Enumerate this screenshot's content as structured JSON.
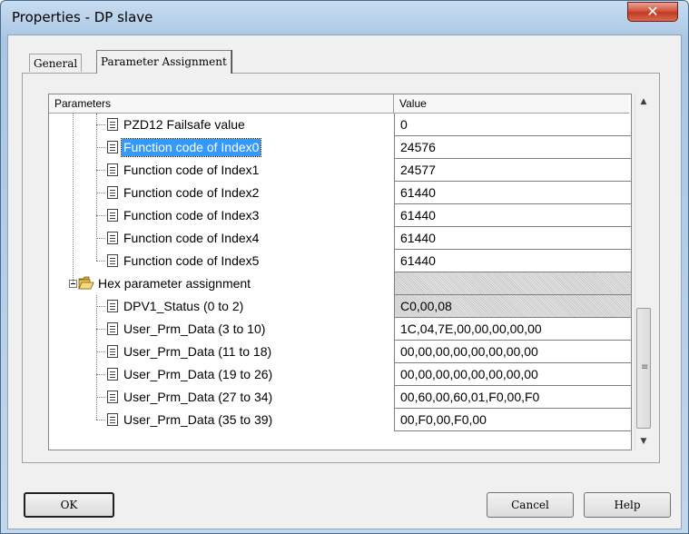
{
  "window": {
    "title": "Properties - DP slave",
    "close_glyph": "✕"
  },
  "tabs": [
    {
      "label": "General",
      "active": false
    },
    {
      "label": "Parameter Assignment",
      "active": true
    }
  ],
  "grid": {
    "columns": {
      "name": "Parameters",
      "value": "Value"
    },
    "rows": [
      {
        "label": "PZD12 Failsafe value",
        "value": "0",
        "kind": "item",
        "selected": false
      },
      {
        "label": "Function code of Index0",
        "value": "24576",
        "kind": "item",
        "selected": true
      },
      {
        "label": "Function code of Index1",
        "value": "24577",
        "kind": "item",
        "selected": false
      },
      {
        "label": "Function code of Index2",
        "value": "61440",
        "kind": "item",
        "selected": false
      },
      {
        "label": "Function code of Index3",
        "value": "61440",
        "kind": "item",
        "selected": false
      },
      {
        "label": "Function code of Index4",
        "value": "61440",
        "kind": "item",
        "selected": false
      },
      {
        "label": "Function code of Index5",
        "value": "61440",
        "kind": "item",
        "selected": false
      },
      {
        "label": "Hex parameter assignment",
        "value": "",
        "kind": "folder",
        "selected": false
      },
      {
        "label": "DPV1_Status (0 to 2)",
        "value": "C0,00,08",
        "kind": "item-hatched",
        "selected": false
      },
      {
        "label": "User_Prm_Data (3 to 10)",
        "value": "1C,04,7E,00,00,00,00,00",
        "kind": "item",
        "selected": false
      },
      {
        "label": "User_Prm_Data (11 to 18)",
        "value": "00,00,00,00,00,00,00,00",
        "kind": "item",
        "selected": false
      },
      {
        "label": "User_Prm_Data (19 to 26)",
        "value": "00,00,00,00,00,00,00,00",
        "kind": "item",
        "selected": false
      },
      {
        "label": "User_Prm_Data (27 to 34)",
        "value": "00,60,00,60,01,F0,00,F0",
        "kind": "item",
        "selected": false
      },
      {
        "label": "User_Prm_Data (35 to 39)",
        "value": "00,F0,00,F0,00",
        "kind": "item",
        "selected": false
      }
    ]
  },
  "buttons": {
    "ok": "OK",
    "cancel": "Cancel",
    "help": "Help"
  },
  "icons": {
    "close": "close-icon",
    "document": "document-icon",
    "folder": "open-folder-icon",
    "collapse": "collapse-minus-icon",
    "scroll_up": "scroll-up-arrow-icon",
    "scroll_down": "scroll-down-arrow-icon"
  },
  "colors": {
    "selection": "#3399ff",
    "close_button": "#c13a22",
    "titlebar": "#b3cde8"
  }
}
